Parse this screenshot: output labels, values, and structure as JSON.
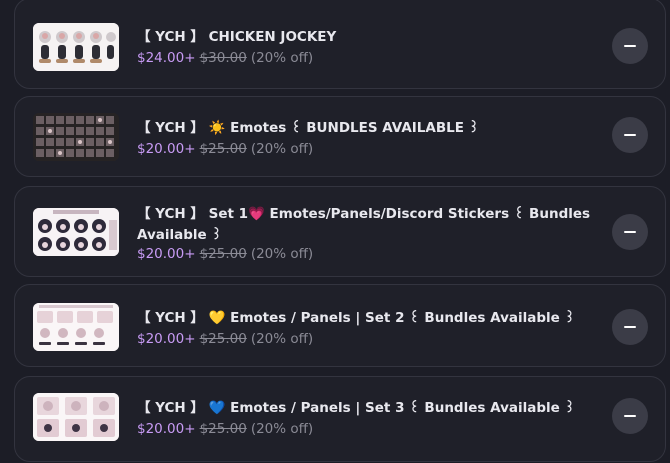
{
  "items": [
    {
      "title": "【 YCH 】 CHICKEN JOCKEY",
      "price": "$24.00+",
      "old_price": "$30.00",
      "discount": "(20% off)",
      "remove_icon": "minus-icon"
    },
    {
      "title": "【 YCH 】 ☀️ Emotes ꒰ BUNDLES AVAILABLE ꒱",
      "price": "$20.00+",
      "old_price": "$25.00",
      "discount": "(20% off)",
      "remove_icon": "minus-icon"
    },
    {
      "title": "【 YCH 】 Set 1💗 Emotes/Panels/Discord Stickers ꒰ Bundles Available ꒱",
      "price": "$20.00+",
      "old_price": "$25.00",
      "discount": "(20% off)",
      "remove_icon": "minus-icon"
    },
    {
      "title": "【 YCH 】 💛 Emotes / Panels | Set 2 ꒰ Bundles Available ꒱",
      "price": "$20.00+",
      "old_price": "$25.00",
      "discount": "(20% off)",
      "remove_icon": "minus-icon"
    },
    {
      "title": "【 YCH 】 💙 Emotes / Panels | Set 3 ꒰ Bundles Available ꒱",
      "price": "$20.00+",
      "old_price": "$25.00",
      "discount": "(20% off)",
      "remove_icon": "minus-icon"
    }
  ],
  "colors": {
    "background": "#1c1d26",
    "card_border": "#33343f",
    "price": "#c89bf5",
    "muted": "#8b8b96",
    "button": "#3b3c47"
  }
}
